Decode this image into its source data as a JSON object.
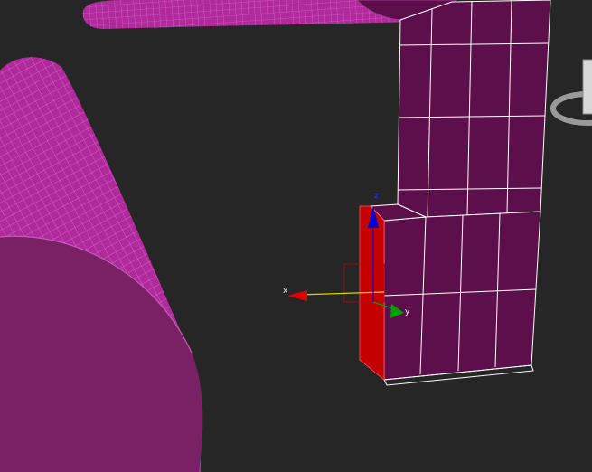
{
  "viewport": {
    "background": "#262626",
    "colors": {
      "cylinder": "#b02a9c",
      "cylinder_wire": "#e070d6",
      "cylinder_cap": "#7a2065",
      "box": "#5c0f4b",
      "box_edges": "#ffffff",
      "selected_face": "#c40000",
      "axis_x": "#e00000",
      "axis_y": "#00a000",
      "axis_z": "#0000d0",
      "axis_x_line": "#d6d600"
    }
  },
  "gizmo": {
    "x_label": "x",
    "y_label": "y",
    "z_label": "z"
  },
  "viewcube": {
    "icon": "viewcube-icon"
  }
}
